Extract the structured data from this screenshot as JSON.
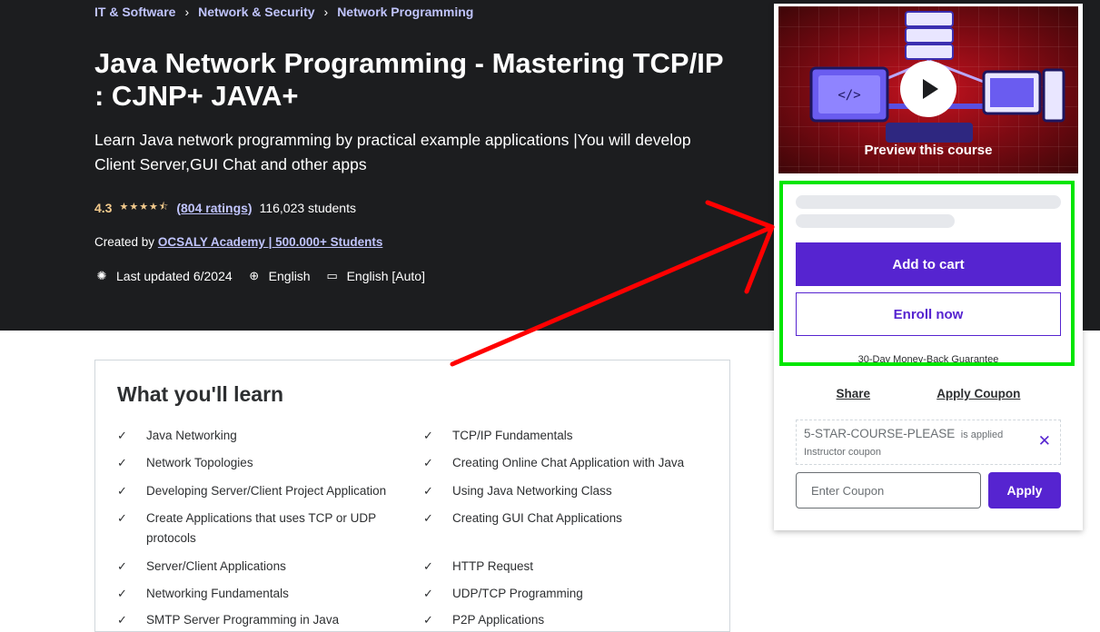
{
  "breadcrumb": [
    "IT & Software",
    "Network & Security",
    "Network Programming"
  ],
  "course": {
    "title": "Java Network Programming - Mastering TCP/IP : CJNP+ JAVA+",
    "subtitle": "Learn Java network programming by practical example applications |You will develop Client Server,GUI Chat and other apps",
    "rating": "4.3",
    "rating_value": 4.3,
    "stars": "★★★★⯪",
    "ratings_count": "(804 ratings)",
    "students": "116,023 students",
    "created_by_label": "Created by",
    "instructor": "OCSALY Academy | 500.000+ Students",
    "last_updated": "Last updated 6/2024",
    "language": "English",
    "captions": "English [Auto]"
  },
  "learn": {
    "title": "What you'll learn",
    "items": [
      "Java Networking",
      "TCP/IP Fundamentals",
      "Network Topologies",
      "Creating Online Chat Application with Java",
      "Developing Server/Client Project Application",
      "Using Java Networking Class",
      "Create Applications that uses TCP or UDP protocols",
      "Creating GUI Chat Applications",
      "Server/Client Applications",
      "HTTP Request",
      "Networking Fundamentals",
      "UDP/TCP Programming",
      "SMTP Server Programming in Java",
      "P2P Applications"
    ]
  },
  "sidebar": {
    "preview_label": "Preview this course",
    "add_to_cart": "Add to cart",
    "enroll_now": "Enroll now",
    "guarantee": "30-Day Money-Back Guarantee",
    "share": "Share",
    "apply_coupon": "Apply Coupon",
    "coupon_code": "5-STAR-COURSE-PLEASE",
    "coupon_applied": "is applied",
    "coupon_type": "Instructor coupon",
    "coupon_placeholder": "Enter Coupon",
    "apply": "Apply"
  },
  "annotation": {
    "highlight_color": "#00e600",
    "arrow_color": "#ff0000"
  },
  "colors": {
    "hero_bg": "#1c1d1f",
    "accent": "#5624d0",
    "link": "#c0c4fc",
    "star": "#f3ca8c"
  }
}
